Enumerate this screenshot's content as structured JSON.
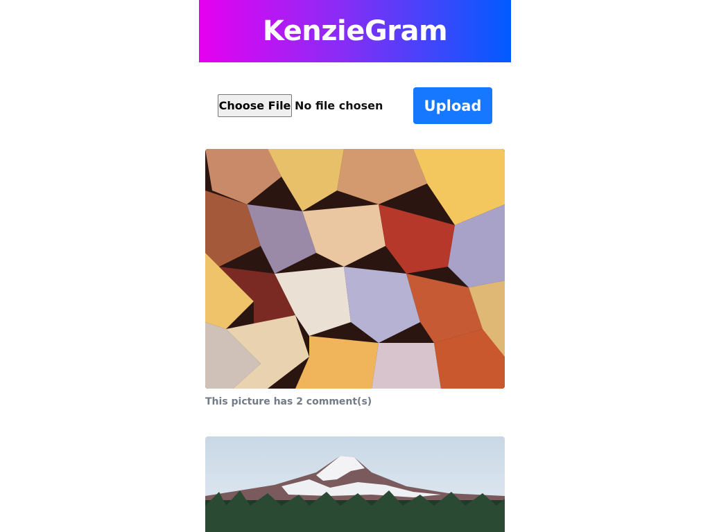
{
  "header": {
    "title": "KenzieGram",
    "gradient": [
      "#e600f0",
      "#005cff"
    ]
  },
  "upload_form": {
    "file_button_label": "Choose File",
    "file_status": "No file chosen",
    "upload_label": "Upload",
    "upload_color": "#1677ff"
  },
  "feed": {
    "posts": [
      {
        "image": "autumn-leaves-photo",
        "caption": "This picture has 2 comment(s)"
      },
      {
        "image": "snowy-mountain-photo"
      }
    ]
  }
}
